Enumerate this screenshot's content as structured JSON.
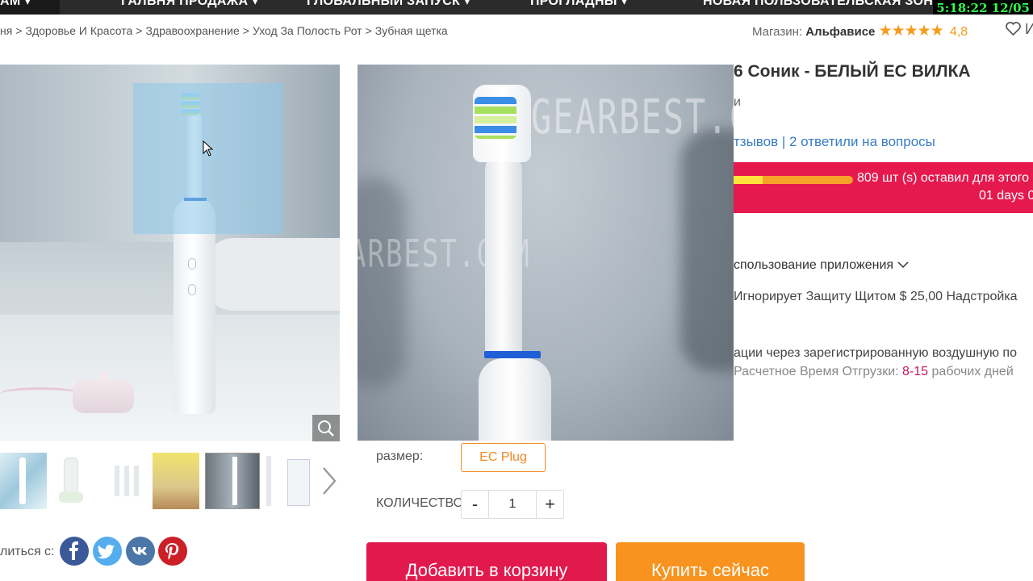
{
  "nav": {
    "items": [
      "АМ ▾",
      "ГАЛЬНЯ ПРОДАЖА ▾",
      "ГЛОБАЛЬНЫЙ ЗАПУСК ▾",
      "ПРОГЛАДНЫ ▾",
      "НОВАЯ ПОЛЬЗОВАТЕЛЬСКАЯ ЗОНА ▾"
    ]
  },
  "clock": "5:18:22  12/05",
  "breadcrumb": {
    "items": [
      "ня",
      "Здоровье И Красота",
      "Здравоохранение",
      "Уход За Полость Рот",
      "Зубная щетка"
    ],
    "separator": ">"
  },
  "store": {
    "label": "Магазин:",
    "name": "Альфависе",
    "rating": "4,8",
    "stars": "★★★★★",
    "wishlist": "И"
  },
  "product": {
    "title": "6 Соник - БЕЛЫЙ ЕС ВИЛКА",
    "subtitle": "и",
    "reviews": "тзывов | 2 ответили на вопросы",
    "watermark_1": "GEARBEST.COM",
    "watermark_2": "ARBEST.COM"
  },
  "flash_sale": {
    "stock_text": "809 шт (s) оставил для этого",
    "time_text": "01 days 0",
    "progress_fraction": 0.24
  },
  "info": {
    "app_usage": "спользование приложения",
    "ignore_shield": "Игнорирует Защиту Щитом $ 25,00 Надстройка",
    "shipping_line": "ации через зарегистрированную воздушную по",
    "eta_prefix": "Расчетное Время Отгрузки:",
    "eta_days": "8-15",
    "eta_suffix": "рабочих дней"
  },
  "options": {
    "size_label": "размер:",
    "size_value": "EC Plug",
    "qty_label": "КОЛИЧЕСТВО",
    "qty_value": "1",
    "qty_minus": "-",
    "qty_plus": "+"
  },
  "share": {
    "label": "литься с:",
    "networks": [
      "facebook",
      "twitter",
      "vk",
      "pinterest"
    ]
  },
  "buttons": {
    "add_to_cart": "Добавить в корзину",
    "buy_now": "Купить сейчас"
  },
  "colors": {
    "accent_red": "#e1194d",
    "accent_orange": "#f7931e",
    "link_blue": "#3a7cc4",
    "star": "#f39c1a"
  },
  "icons": {
    "wishlist": "heart-icon",
    "zoom": "magnifier-icon",
    "next_thumb": "chevron-right-icon",
    "app_usage_toggle": "chevron-down-icon"
  }
}
